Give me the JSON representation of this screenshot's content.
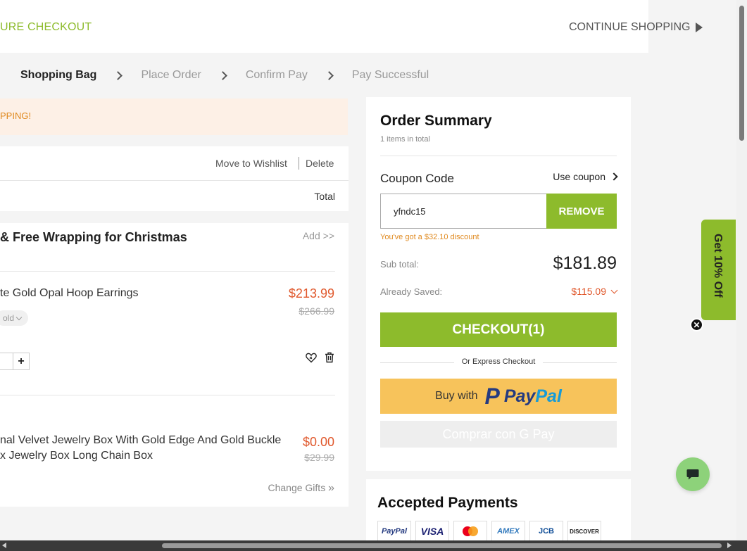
{
  "header": {
    "secure_checkout": "URE CHECKOUT",
    "continue_shopping": "CONTINUE SHOPPING"
  },
  "steps": [
    {
      "label": "Shopping Bag",
      "active": true
    },
    {
      "label": "Place Order",
      "active": false
    },
    {
      "label": "Confirm Pay",
      "active": false
    },
    {
      "label": "Pay Successful",
      "active": false
    }
  ],
  "banner": {
    "text": "PPING!"
  },
  "cart_actions": {
    "move_to_wishlist": "Move to Wishlist",
    "delete": "Delete",
    "total_header": "Total"
  },
  "gift_wrap": {
    "title": "& Free Wrapping for Christmas",
    "add_link": "Add >>"
  },
  "items": [
    {
      "name": "te Gold Opal Hoop Earrings",
      "price": "$213.99",
      "old_price": "$266.99",
      "variant": "old"
    },
    {
      "name_line1": "nal Velvet Jewelry Box With Gold Edge And Gold Buckle",
      "name_line2": "x Jewelry Box Long Chain Box",
      "price": "$0.00",
      "old_price": "$29.99"
    }
  ],
  "change_gifts": "Change Gifts",
  "order_summary": {
    "title": "Order Summary",
    "count": "1 items in total",
    "coupon_label": "Coupon Code",
    "use_coupon": "Use coupon",
    "coupon_value": "yfndc15",
    "remove": "REMOVE",
    "discount_note": "You've got a $32.10 discount",
    "subtotal_label": "Sub total:",
    "subtotal_value": "$181.89",
    "saved_label": "Already Saved:",
    "saved_value": "$115.09",
    "checkout": "CHECKOUT(1)",
    "express": "Or Express Checkout",
    "paypal_buy_with": "Buy with",
    "paypal_word_a": "Pay",
    "paypal_word_b": "Pal",
    "gpay": "Comprar con G Pay"
  },
  "accepted_payments": {
    "title": "Accepted Payments",
    "methods": [
      "PayPal",
      "VISA",
      "mastercard",
      "AMEX",
      "JCB",
      "DISCOVER"
    ]
  },
  "promo_tab": "Get 10% Off",
  "colors": {
    "accent": "#8dbb2c",
    "price": "#e0582c",
    "note": "#e08a20",
    "paypal_yellow": "#f7c35b"
  }
}
